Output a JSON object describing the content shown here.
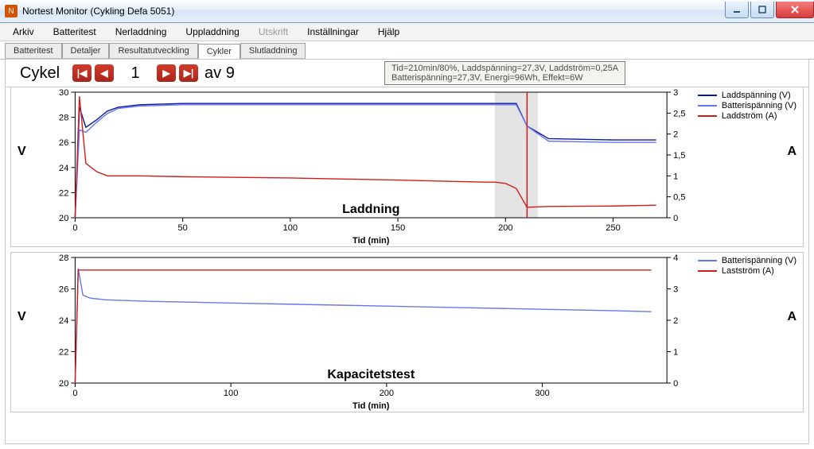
{
  "window": {
    "title": "Nortest Monitor (Cykling Defa 5051)",
    "icon_letter": "N"
  },
  "menu": {
    "items": [
      "Arkiv",
      "Batteritest",
      "Nerladdning",
      "Uppladdning",
      "Utskrift",
      "Inställningar",
      "Hjälp"
    ],
    "disabled_index": 4
  },
  "tabs": {
    "items": [
      "Batteritest",
      "Detaljer",
      "Resultatutveckling",
      "Cykler",
      "Slutladdning"
    ],
    "active_index": 3
  },
  "pager": {
    "label": "Cykel",
    "current": "1",
    "total": "9",
    "of_prefix": "av"
  },
  "tooltip": {
    "line1": "Tid=210min/80%, Laddspänning=27,3V, Laddström=0,25A",
    "line2": "Batterispänning=27,3V, Energi=96Wh, Effekt=6W"
  },
  "chart_top": {
    "title": "Laddning",
    "xlabel": "Tid (min)",
    "ylabel_left": "V",
    "ylabel_right": "A",
    "legend": [
      {
        "name": "Laddspänning (V)",
        "color": "#0a1a9a",
        "axis": "left"
      },
      {
        "name": "Batterispänning (V)",
        "color": "#6676f0",
        "axis": "left"
      },
      {
        "name": "Laddström (A)",
        "color": "#d21c1c",
        "axis": "right"
      }
    ],
    "x_ticks": [
      0,
      50,
      100,
      150,
      200,
      250
    ],
    "y_left_ticks": [
      20,
      22,
      24,
      26,
      28,
      30
    ],
    "y_right_ticks": [
      0,
      0.5,
      1,
      1.5,
      2,
      2.5,
      3
    ]
  },
  "chart_bottom": {
    "title": "Kapacitetstest",
    "xlabel": "Tid (min)",
    "ylabel_left": "V",
    "ylabel_right": "A",
    "legend": [
      {
        "name": "Batterispänning (V)",
        "color": "#6676f0",
        "axis": "left"
      },
      {
        "name": "Lastström (A)",
        "color": "#d21c1c",
        "axis": "right"
      }
    ],
    "x_ticks": [
      0,
      100,
      200,
      300
    ],
    "y_left_ticks": [
      20,
      22,
      24,
      26,
      28
    ],
    "y_right_ticks": [
      0,
      1,
      2,
      3,
      4
    ]
  },
  "chart_data": [
    {
      "type": "line",
      "title": "Laddning",
      "xlabel": "Tid (min)",
      "x": [
        0,
        2,
        5,
        10,
        15,
        20,
        30,
        50,
        100,
        150,
        190,
        195,
        200,
        205,
        210,
        220,
        250,
        270
      ],
      "series": [
        {
          "name": "Laddspänning (V)",
          "axis": "left",
          "values": [
            20.0,
            28.8,
            27.2,
            27.8,
            28.5,
            28.8,
            29.0,
            29.1,
            29.1,
            29.1,
            29.1,
            29.1,
            29.1,
            29.1,
            27.3,
            26.3,
            26.2,
            26.2
          ]
        },
        {
          "name": "Batterispänning (V)",
          "axis": "left",
          "values": [
            20.0,
            27.0,
            26.8,
            27.6,
            28.3,
            28.7,
            28.9,
            29.0,
            29.0,
            29.0,
            29.0,
            29.0,
            29.0,
            29.0,
            27.3,
            26.1,
            26.0,
            26.0
          ]
        },
        {
          "name": "Laddström (A)",
          "axis": "right",
          "values": [
            0.0,
            2.9,
            1.3,
            1.1,
            1.0,
            1.0,
            1.0,
            0.98,
            0.95,
            0.9,
            0.85,
            0.85,
            0.82,
            0.7,
            0.25,
            0.27,
            0.28,
            0.3
          ]
        }
      ],
      "xlim": [
        0,
        275
      ],
      "ylim_left": [
        20,
        30
      ],
      "ylim_right": [
        0,
        3
      ],
      "highlight_band": {
        "x0": 195,
        "x1": 215
      },
      "cursor_x": 210
    },
    {
      "type": "line",
      "title": "Kapacitetstest",
      "xlabel": "Tid (min)",
      "x": [
        0,
        2,
        5,
        10,
        20,
        50,
        100,
        150,
        200,
        250,
        300,
        350,
        370
      ],
      "series": [
        {
          "name": "Batterispänning (V)",
          "axis": "left",
          "values": [
            20.0,
            27.3,
            25.6,
            25.4,
            25.3,
            25.2,
            25.1,
            25.0,
            24.9,
            24.8,
            24.7,
            24.6,
            24.55
          ]
        },
        {
          "name": "Lastström (A)",
          "axis": "right",
          "values": [
            0.0,
            3.6,
            3.6,
            3.6,
            3.6,
            3.6,
            3.6,
            3.6,
            3.6,
            3.6,
            3.6,
            3.6,
            3.6
          ]
        }
      ],
      "xlim": [
        0,
        380
      ],
      "ylim_left": [
        20,
        28
      ],
      "ylim_right": [
        0,
        4
      ]
    }
  ]
}
